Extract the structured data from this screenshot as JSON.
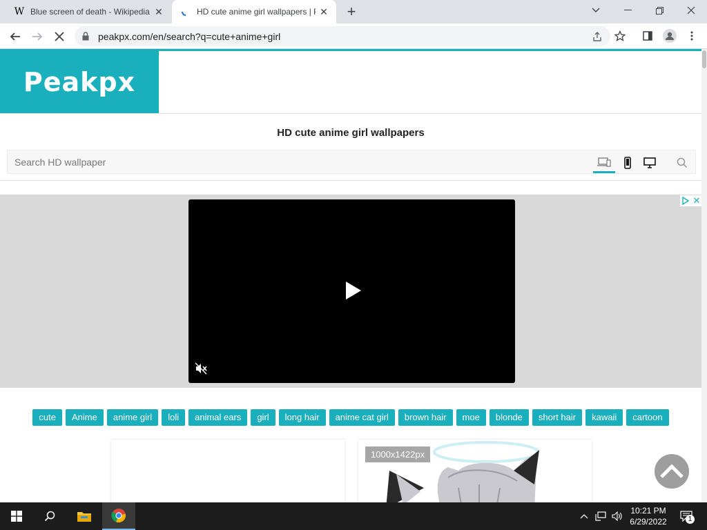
{
  "browser": {
    "tabs": [
      {
        "title": "Blue screen of death - Wikipedia",
        "favicon": "W",
        "active": false
      },
      {
        "title": "HD cute anime girl wallpapers | P",
        "favicon": "loading-spinner-icon",
        "active": true
      }
    ],
    "new_tab": "+",
    "url": "peakpx.com/en/search?q=cute+anime+girl"
  },
  "site": {
    "logo": "Peakpx",
    "page_title": "HD cute anime girl wallpapers",
    "search": {
      "placeholder": "Search HD wallpaper",
      "value": ""
    },
    "device_filters": [
      "laptop-phone-icon",
      "phone-icon",
      "desktop-icon"
    ],
    "tags": [
      "cute",
      "Anime",
      "anime girl",
      "loli",
      "animal ears",
      "girl",
      "long hair",
      "anime cat girl",
      "brown hair",
      "moe",
      "blonde",
      "short hair",
      "kawaii",
      "cartoon"
    ],
    "cards": [
      {
        "resolution": ""
      },
      {
        "resolution": "1000x1422px"
      }
    ],
    "accent_color": "#1aafbd"
  },
  "taskbar": {
    "time": "10:21 PM",
    "date": "6/29/2022",
    "notification_count": "1"
  }
}
